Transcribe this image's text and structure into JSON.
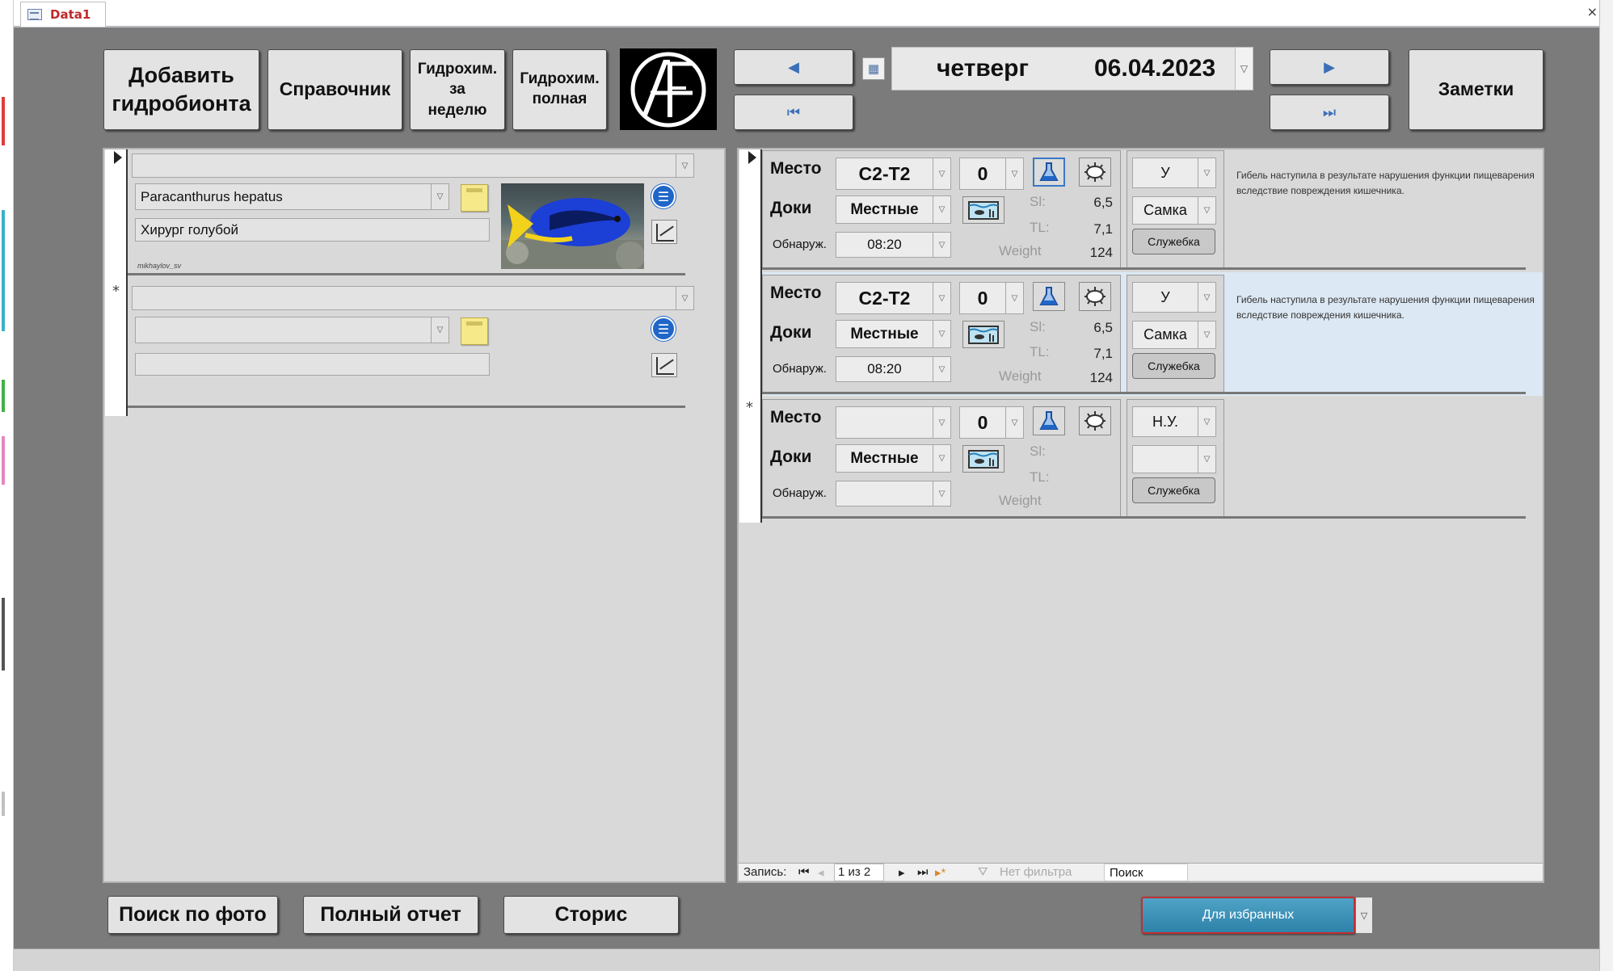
{
  "window": {
    "tab_title": "Data1",
    "close_glyph": "×"
  },
  "toolbar": {
    "add_hydrobiont_line1": "Добавить",
    "add_hydrobiont_line2": "гидробионта",
    "reference": "Справочник",
    "hydrochem_week_line1": "Гидрохим.",
    "hydrochem_week_line2": "за",
    "hydrochem_week_line3": "неделю",
    "hydrochem_full_line1": "Гидрохим.",
    "hydrochem_full_line2": "полная",
    "notes": "Заметки",
    "day_of_week": "четверг",
    "date": "06.04.2023",
    "prev_glyph": "◀",
    "first_glyph": "⏮",
    "next_glyph": "▶",
    "last_glyph": "⏭"
  },
  "left_panel": {
    "record1": {
      "latin_name": "Paracanthurus hepatus",
      "common_name": "Хирург голубой",
      "photo_credit": "mikhaylov_sv"
    },
    "new_record_marker": "*"
  },
  "right_panel": {
    "labels": {
      "place": "Место",
      "docks": "Доки",
      "detected": "Обнаруж.",
      "sl": "Sl:",
      "tl": "TL:",
      "weight": "Weight",
      "service": "Служебка"
    },
    "records": [
      {
        "place": "С2-Т2",
        "count": "0",
        "docks": "Местные",
        "time": "08:20",
        "sl": "6,5",
        "tl": "7,1",
        "weight": "124",
        "status": "У",
        "sex": "Самка",
        "cause": "Гибель наступила в результате нарушения функции пищеварения вследствие повреждения кишечника."
      },
      {
        "place": "С2-Т2",
        "count": "0",
        "docks": "Местные",
        "time": "08:20",
        "sl": "6,5",
        "tl": "7,1",
        "weight": "124",
        "status": "У",
        "sex": "Самка",
        "cause": "Гибель наступила в результате нарушения функции пищеварения вследствие повреждения кишечника."
      },
      {
        "place": "",
        "count": "0",
        "docks": "Местные",
        "time": "",
        "sl": "",
        "tl": "",
        "weight": "",
        "status": "Н.У.",
        "sex": "",
        "cause": ""
      }
    ],
    "new_record_marker": "*"
  },
  "record_nav": {
    "label": "Запись:",
    "position": "1 из 2",
    "filter": "Нет фильтра",
    "search": "Поиск"
  },
  "bottom": {
    "photo_search": "Поиск по фото",
    "full_report": "Полный отчет",
    "stories": "Сторис",
    "favorites": "Для избранных"
  },
  "colors": {
    "background": "#7b7b7b",
    "panel": "#d9d9d9",
    "accent_blue": "#1f66c8",
    "favorites_button": "#3a8fb5",
    "tab_title": "#c0292b",
    "selected_row": "#dce8f3"
  },
  "icons": [
    "form-icon",
    "calendar-icon",
    "sticky-note-icon",
    "list-icon",
    "chart-icon",
    "flask-icon",
    "germ-icon",
    "aquarium-icon",
    "dropdown-arrow-icon"
  ]
}
